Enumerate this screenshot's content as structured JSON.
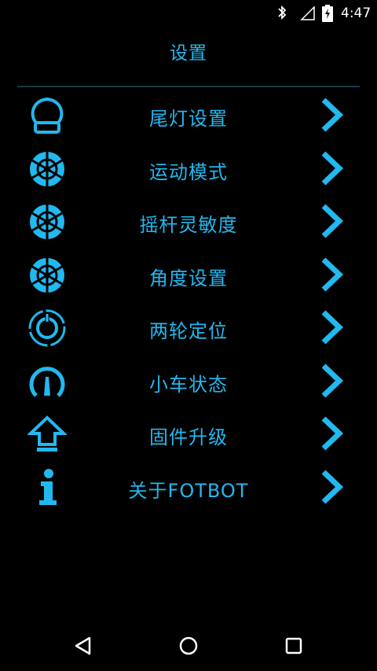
{
  "status_bar": {
    "time": "4:47"
  },
  "title": "设置",
  "menu": {
    "items": [
      {
        "label": "尾灯设置",
        "icon": "tail-light-icon"
      },
      {
        "label": "运动模式",
        "icon": "wheel-icon"
      },
      {
        "label": "摇杆灵敏度",
        "icon": "wheel-icon"
      },
      {
        "label": "角度设置",
        "icon": "wheel-icon"
      },
      {
        "label": "两轮定位",
        "icon": "balance-icon"
      },
      {
        "label": "小车状态",
        "icon": "gauge-icon"
      },
      {
        "label": "固件升级",
        "icon": "upgrade-arrow-icon"
      },
      {
        "label": "关于FOTBOT",
        "icon": "info-icon"
      }
    ]
  },
  "colors": {
    "accent": "#22b8f0",
    "background": "#000000",
    "divider": "#1a3a48"
  }
}
